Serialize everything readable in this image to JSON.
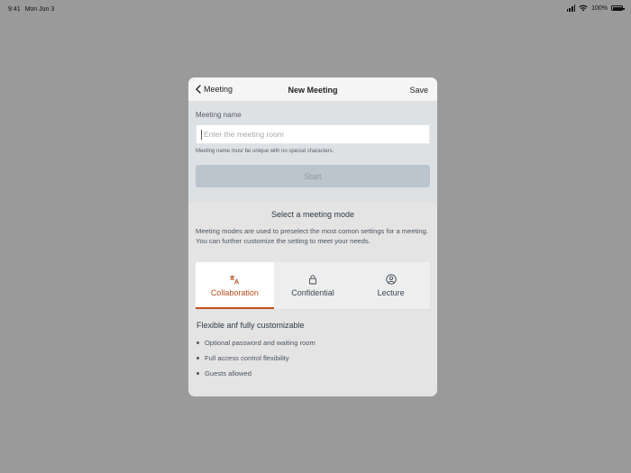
{
  "status_bar": {
    "time": "9:41",
    "date": "Mon Jun 3",
    "battery": "100%"
  },
  "nav": {
    "back_label": "Meeting",
    "title": "New Meeting",
    "save_label": "Save"
  },
  "form": {
    "name_label": "Meeting name",
    "name_value": "",
    "name_placeholder": "Enter the meeting room",
    "helper_text": "Meeting name musr be unique with no special characters.",
    "start_label": "Start"
  },
  "mode": {
    "title": "Select a meeting mode",
    "description": "Meeting modes are used to preselect the most comon settings for a meeting. You can further customize the setting to meet your needs.",
    "tabs": [
      {
        "label": "Collaboration",
        "icon": "collaboration-icon",
        "selected": true
      },
      {
        "label": "Confidential",
        "icon": "lock-icon",
        "selected": false
      },
      {
        "label": "Lecture",
        "icon": "person-icon",
        "selected": false
      }
    ]
  },
  "feature": {
    "title": "Flexible anf fully customizable",
    "items": [
      "Optional password and waiting room",
      "Full access control flexibility",
      "Guests allowed"
    ]
  },
  "colors": {
    "accent": "#c2521f",
    "backdrop": "#9a9a9a",
    "start_button_disabled": "#bcc5cd"
  }
}
